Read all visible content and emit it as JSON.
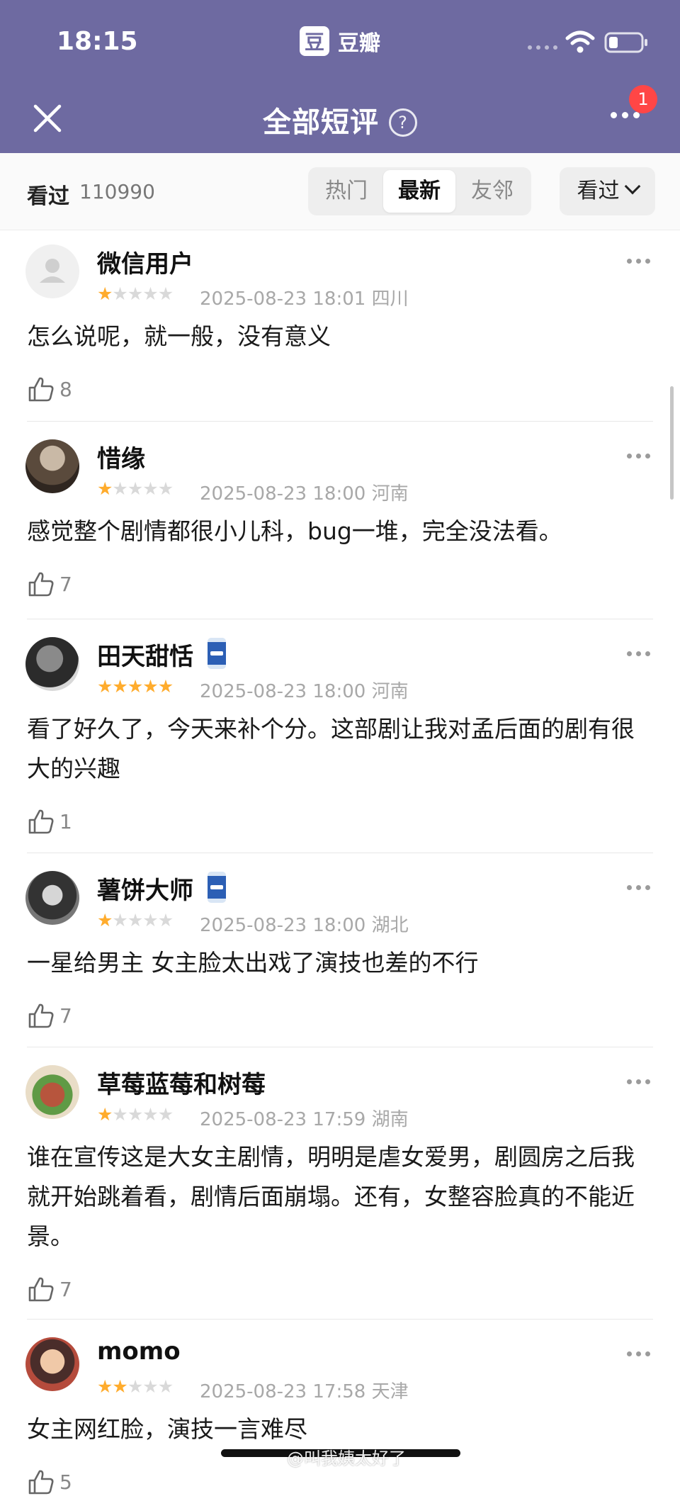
{
  "status": {
    "time": "18:15",
    "app_logo": "豆",
    "app_name": "豆瓣"
  },
  "nav": {
    "title": "全部短评",
    "help": "?",
    "notification_count": "1"
  },
  "filters": {
    "seen_label": "看过",
    "seen_count": "110990",
    "tabs": [
      "热门",
      "最新",
      "友邻"
    ],
    "active_tab": "最新",
    "select_label": "看过"
  },
  "reviews": [
    {
      "user": "微信用户",
      "rating": 1,
      "date": "2025-08-23 18:01",
      "location": "四川",
      "text": "怎么说呢，就一般，没有意义",
      "likes": "8",
      "badge": false
    },
    {
      "user": "惜缘",
      "rating": 1,
      "date": "2025-08-23 18:00",
      "location": "河南",
      "text": "感觉整个剧情都很小儿科，bug一堆，完全没法看。",
      "likes": "7",
      "badge": false
    },
    {
      "user": "田天甜恬",
      "rating": 5,
      "date": "2025-08-23 18:00",
      "location": "河南",
      "text": "看了好久了，今天来补个分。这部剧让我对孟后面的剧有很大的兴趣",
      "likes": "1",
      "badge": true
    },
    {
      "user": "薯饼大师",
      "rating": 1,
      "date": "2025-08-23 18:00",
      "location": "湖北",
      "text": "一星给男主  女主脸太出戏了演技也差的不行",
      "likes": "7",
      "badge": true
    },
    {
      "user": "草莓蓝莓和树莓",
      "rating": 1,
      "date": "2025-08-23 17:59",
      "location": "湖南",
      "text": "谁在宣传这是大女主剧情，明明是虐女爱男，剧圆房之后我就开始跳着看，剧情后面崩塌。还有，女整容脸真的不能近景。",
      "likes": "7",
      "badge": false
    },
    {
      "user": "momo",
      "rating": 2,
      "date": "2025-08-23 17:58",
      "location": "天津",
      "text": "女主网红脸，演技一言难尽",
      "likes": "5",
      "badge": false
    }
  ],
  "watermark": "@叫我姨太好了",
  "colors": {
    "header": "#6e6aa1",
    "star_on": "#ffac2d",
    "star_off": "#d9d9d9",
    "badge": "#ff4646"
  }
}
